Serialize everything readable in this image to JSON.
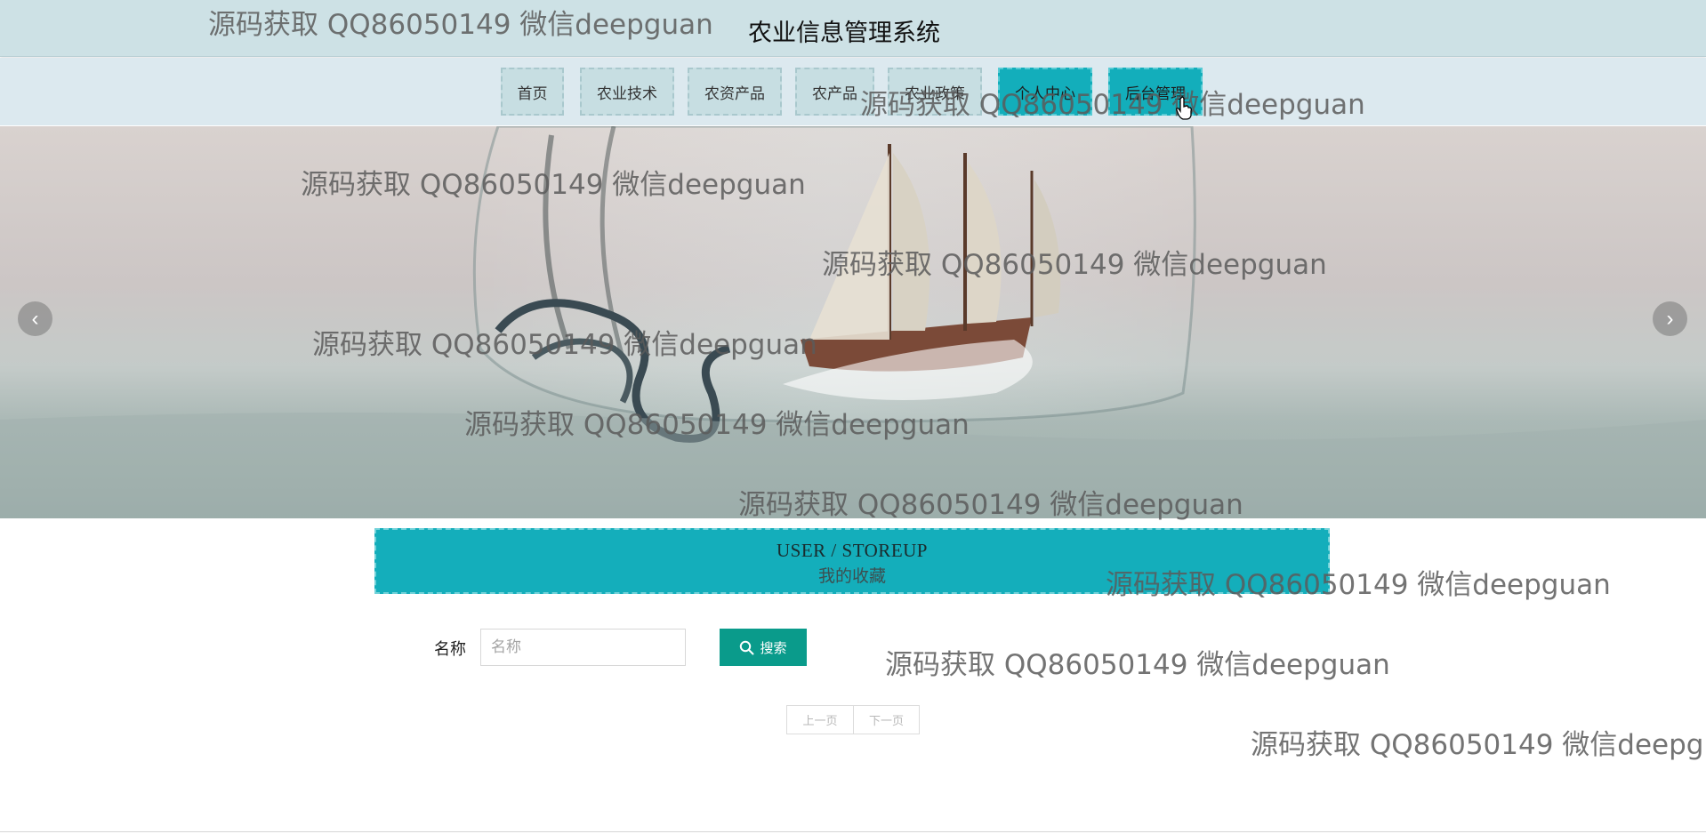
{
  "app": {
    "title": "农业信息管理系统"
  },
  "nav": {
    "items": [
      {
        "label": "首页"
      },
      {
        "label": "农业技术"
      },
      {
        "label": "农资产品"
      },
      {
        "label": "农产品"
      },
      {
        "label": "农业政策"
      },
      {
        "label": "个人中心"
      },
      {
        "label": "后台管理"
      }
    ]
  },
  "banner": {
    "prev_icon": "chevron-left-icon",
    "next_icon": "chevron-right-icon",
    "prev_glyph": "‹",
    "next_glyph": "›"
  },
  "section": {
    "title_en": "USER / STOREUP",
    "title_cn": "我的收藏"
  },
  "search": {
    "label": "名称",
    "placeholder": "名称",
    "value": "",
    "button_label": "搜索",
    "button_icon": "search-icon"
  },
  "pagination": {
    "prev_label": "上一页",
    "next_label": "下一页"
  },
  "watermark": {
    "text": "源码获取 QQ86050149 微信deepguan"
  },
  "colors": {
    "accent": "#14aebb",
    "search_button": "#0a9b8b",
    "topbar": "#cde1e5",
    "navbar": "#dce9ef"
  }
}
